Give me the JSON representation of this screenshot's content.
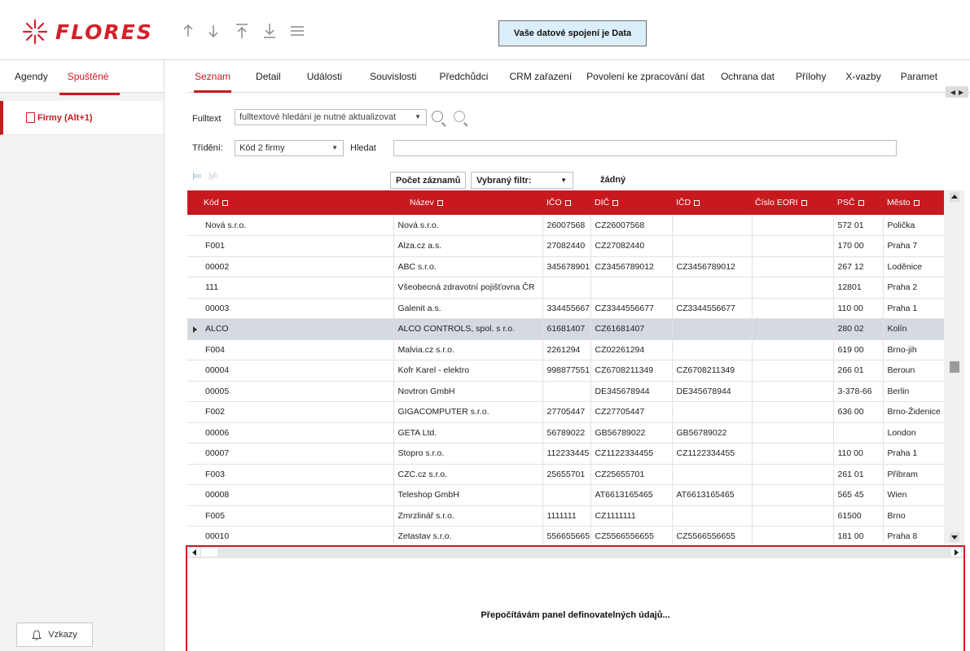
{
  "app": {
    "logo_text": "FLORES",
    "connection_banner": "Vaše datové spojení je Data",
    "brand_color": "#c8191f"
  },
  "toolbar": {
    "icons": [
      "arrow-up-icon",
      "arrow-down-icon",
      "move-top-icon",
      "move-bottom-icon",
      "menu-icon"
    ]
  },
  "left": {
    "tabs": [
      "Agendy",
      "Spuštěné"
    ],
    "active_tab": "Spuštěné",
    "running_item": "Firmy (Alt+1)",
    "messages_button": "Vzkazy"
  },
  "main": {
    "tabs": [
      "Seznam",
      "Detail",
      "Události",
      "Souvislosti",
      "Předchůdci",
      "CRM zařazení",
      "Povolení ke zpracování dat",
      "Ochrana dat",
      "Přílohy",
      "X-vazby",
      "Paramet"
    ],
    "active_tab": "Seznam"
  },
  "filters": {
    "fulltext_label": "Fulltext",
    "fulltext_value": "fulltextové hledání je nutné aktualizovat",
    "sort_label": "Třídění:",
    "sort_value": "Kód 2 firmy",
    "search_label": "Hledat",
    "search_value": "",
    "count_button": "Počet záznamů",
    "filter_label": "Vybraný filtr:",
    "filter_value": "žádný"
  },
  "grid": {
    "columns": [
      "Kód",
      "Název",
      "IČO",
      "DIČ",
      "IČD",
      "Číslo EORI",
      "PSČ",
      "Město"
    ],
    "selected_row": 5,
    "rows": [
      [
        "Nová s.r.o.",
        "Nová s.r.o.",
        "26007568",
        "CZ26007568",
        "",
        "",
        "572 01",
        "Polička"
      ],
      [
        "F001",
        "Alza.cz a.s.",
        "27082440",
        "CZ27082440",
        "",
        "",
        "170 00",
        "Praha 7"
      ],
      [
        "00002",
        "ABC s.r.o.",
        "345678901",
        "CZ3456789012",
        "CZ3456789012",
        "",
        "267 12",
        "Loděnice"
      ],
      [
        "111",
        "Všeobecná zdravotní pojišťovna ČR",
        "",
        "",
        "",
        "",
        "12801",
        "Praha 2"
      ],
      [
        "00003",
        "Galenit a.s.",
        "334455667",
        "CZ3344556677",
        "CZ3344556677",
        "",
        "110 00",
        "Praha 1"
      ],
      [
        "ALCO",
        "ALCO CONTROLS, spol. s r.o.",
        "61681407",
        "CZ61681407",
        "",
        "",
        "280 02",
        "Kolín"
      ],
      [
        "F004",
        "Malvia.cz s.r.o.",
        "2261294",
        "CZ02261294",
        "",
        "",
        "619 00",
        "Brno-jih"
      ],
      [
        "00004",
        "Kofr Karel - elektro",
        "998877551",
        "CZ6708211349",
        "CZ6708211349",
        "",
        "266 01",
        "Beroun"
      ],
      [
        "00005",
        "Novtron GmbH",
        "",
        "DE345678944",
        "DE345678944",
        "",
        "3-378-66",
        "Berlin"
      ],
      [
        "F002",
        "GIGACOMPUTER s.r.o.",
        "27705447",
        "CZ27705447",
        "",
        "",
        "636 00",
        "Brno-Židenice"
      ],
      [
        "00006",
        "GETA Ltd.",
        "56789022",
        "GB56789022",
        "GB56789022",
        "",
        "",
        "London"
      ],
      [
        "00007",
        "Stopro s.r.o.",
        "112233445",
        "CZ1122334455",
        "CZ1122334455",
        "",
        "110 00",
        "Praha 1"
      ],
      [
        "F003",
        "CZC.cz s.r.o.",
        "25655701",
        "CZ25655701",
        "",
        "",
        "261 01",
        "Příbram"
      ],
      [
        "00008",
        "Teleshop GmbH",
        "",
        "AT6613165465",
        "AT6613165465",
        "",
        "565 45",
        "Wien"
      ],
      [
        "F005",
        "Zmrzlinář s.r.o.",
        "1111111",
        "CZ1111111",
        "",
        "",
        "61500",
        "Brno"
      ],
      [
        "00010",
        "Zetastav s.r.o.",
        "556655665",
        "CZ5566556655",
        "CZ5566556655",
        "",
        "181 00",
        "Praha 8"
      ]
    ]
  },
  "definable_panel": {
    "message": "Přepočítávám panel definovatelných údajů..."
  }
}
